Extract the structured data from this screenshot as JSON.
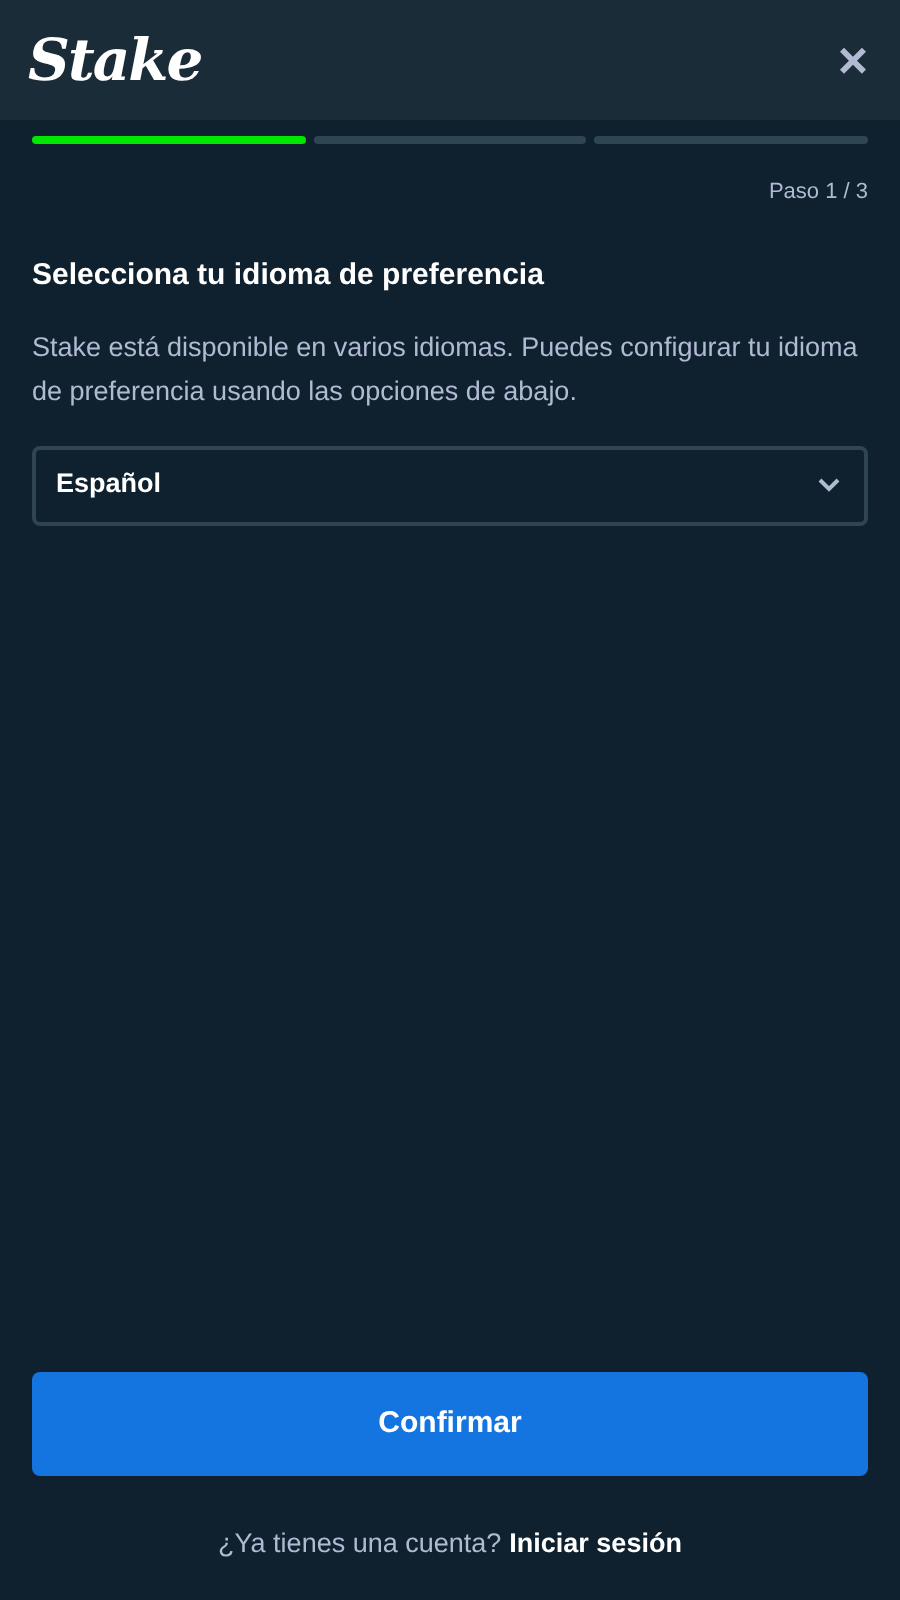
{
  "header": {
    "logo": "Stake",
    "close": "×"
  },
  "steps": [
    {
      "done": true
    },
    {
      "done": false
    },
    {
      "done": false
    }
  ],
  "step_label": "Paso 1 / 3",
  "title": "Selecciona tu idioma de preferencia",
  "description": "Stake está disponible en varios idiomas. Puedes configurar tu idioma de preferencia usando las opciones de abajo.",
  "language_select": {
    "value": "Español"
  },
  "confirm_button": "Confirmar",
  "footer": {
    "question": "¿Ya tienes una cuenta?",
    "link": "Iniciar sesión"
  }
}
